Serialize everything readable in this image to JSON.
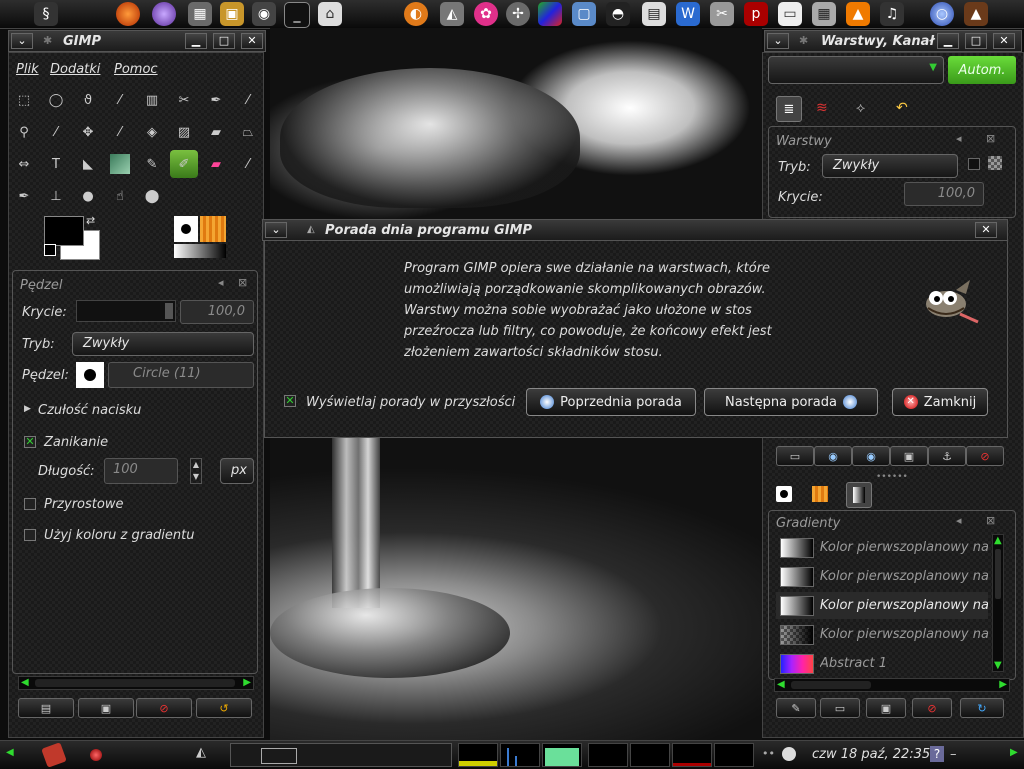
{
  "top_panel": {
    "launchers": [
      "gimp-swirl-icon",
      "firefox-icon",
      "orb-icon",
      "package-icon",
      "box-icon",
      "camera-icon",
      "terminal-icon",
      "home-icon",
      "blender-icon",
      "wilber-icon",
      "flower-icon",
      "compass-icon",
      "cube-icon",
      "screenshot-icon",
      "tux-icon",
      "ooo-icon",
      "writer-icon",
      "scissors-icon",
      "pdf-icon",
      "document-icon",
      "calculator-icon",
      "vlc-icon",
      "headphones-icon",
      "globe-icon",
      "wizard-icon"
    ]
  },
  "toolbox": {
    "title": "GIMP",
    "menu": [
      "Plik",
      "Dodatki",
      "Pomoc"
    ]
  },
  "tool_options": {
    "title": "Pędzel",
    "opacity_label": "Krycie:",
    "opacity_value": "100,0",
    "mode_label": "Tryb:",
    "mode_value": "Zwykły",
    "brush_label": "Pędzel:",
    "brush_value": "Circle (11)",
    "pressure_label": "Czułość nacisku",
    "fade_label": "Zanikanie",
    "length_label": "Długość:",
    "length_value": "100",
    "unit_value": "px",
    "incremental_label": "Przyrostowe",
    "gradient_color_label": "Użyj koloru z gradientu"
  },
  "layers_window": {
    "title": "Warstwy, Kanał",
    "auto_button": "Autom.",
    "panel_title": "Warstwy",
    "mode_label": "Tryb:",
    "mode_value": "Zwykły",
    "opacity_label": "Krycie:",
    "opacity_value": "100,0"
  },
  "gradients": {
    "panel_title": "Gradienty",
    "items": [
      {
        "name": "Kolor pierwszoplanowy na"
      },
      {
        "name": "Kolor pierwszoplanowy na"
      },
      {
        "name": "Kolor pierwszoplanowy na"
      },
      {
        "name": "Kolor pierwszoplanowy na"
      },
      {
        "name": "Abstract 1"
      }
    ]
  },
  "dialog": {
    "title": "Porada dnia programu GIMP",
    "tip_lines": [
      "Program GIMP opiera swe działanie na warstwach, które",
      "umożliwiają porządkowanie skomplikowanych obrazów.",
      "Warstwy można sobie wyobrażać jako ułożone w stos",
      "przeźrocza lub filtry, co powoduje, że końcowy efekt jest",
      "złożeniem zawartości składników stosu."
    ],
    "show_tips_label": "Wyświetlaj porady w przyszłości",
    "prev_button": "Poprzednia porada",
    "next_button": "Następna porada",
    "close_button": "Zamknij"
  },
  "bottom_panel": {
    "clock": "czw 18 paź, 22:35",
    "help_badge": "?"
  },
  "colors": {
    "accent_green": "#3fbf1f",
    "check_green": "#33cc33"
  }
}
